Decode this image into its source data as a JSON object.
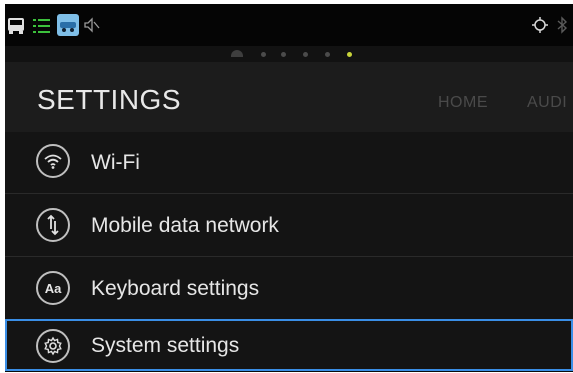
{
  "status_bar": {
    "icons": [
      "bus-icon",
      "list-icon",
      "car-app-icon",
      "muted-speaker-icon",
      "location-icon",
      "bluetooth-icon"
    ],
    "page_indicator": {
      "count": 6,
      "active_index": 5
    }
  },
  "header": {
    "title": "SETTINGS",
    "tabs": [
      "HOME",
      "AUDI"
    ]
  },
  "menu": {
    "items": [
      {
        "label": "Wi-Fi",
        "icon": "wifi-icon"
      },
      {
        "label": "Mobile data network",
        "icon": "mobile-data-icon"
      },
      {
        "label": "Keyboard settings",
        "icon": "keyboard-icon",
        "icon_text": "Aa"
      },
      {
        "label": "System settings",
        "icon": "gear-icon",
        "selected": true
      }
    ]
  },
  "colors": {
    "selection_border": "#3a8ee6",
    "active_dot": "#c8d43a",
    "background": "#0c0c0d"
  }
}
